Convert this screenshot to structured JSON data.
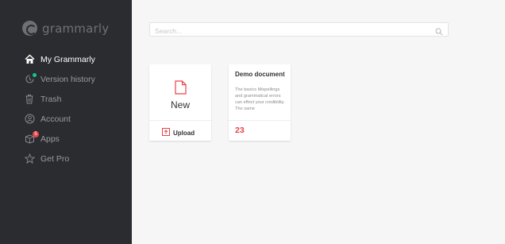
{
  "app": {
    "brand": "grammarly"
  },
  "sidebar": {
    "items": [
      {
        "label": "My Grammarly",
        "icon": "home-icon",
        "active": true
      },
      {
        "label": "Version history",
        "icon": "version-history-icon",
        "active": false
      },
      {
        "label": "Trash",
        "icon": "trash-icon",
        "active": false
      },
      {
        "label": "Account",
        "icon": "account-icon",
        "active": false
      },
      {
        "label": "Apps",
        "icon": "apps-icon",
        "active": false,
        "badge": "5"
      },
      {
        "label": "Get Pro",
        "icon": "star-icon",
        "active": false
      }
    ]
  },
  "search": {
    "placeholder": "Search...",
    "value": ""
  },
  "cards": {
    "new": {
      "label": "New",
      "upload_label": "Upload"
    },
    "demo": {
      "title": "Demo document",
      "preview": "The basics Mispellings and grammatical errors can effect your credibility. The same",
      "alerts": "23"
    }
  },
  "colors": {
    "sidebar_bg": "#2b2c2f",
    "accent_red": "#e8434b",
    "accent_teal": "#15c39a",
    "page_bg": "#f6f6f6"
  }
}
